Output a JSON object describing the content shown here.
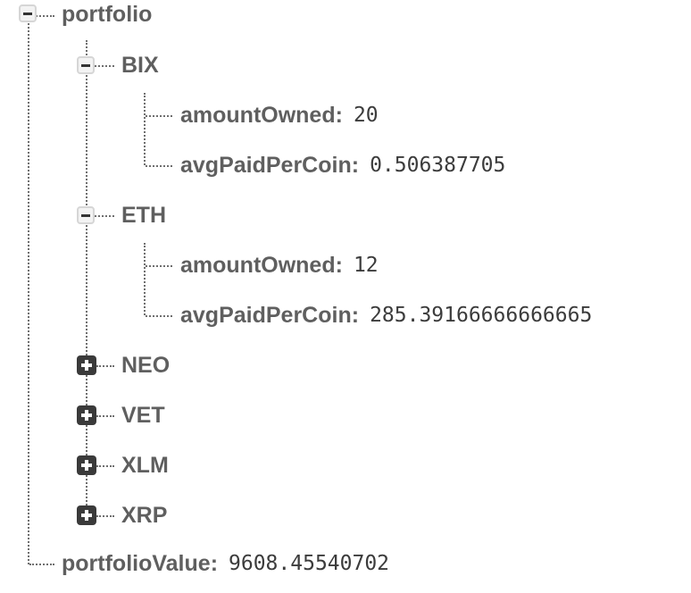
{
  "tree": {
    "root": {
      "key": "portfolio",
      "expanded": true,
      "children": {
        "bix": {
          "key": "BIX",
          "expanded": true,
          "fields": [
            {
              "key": "amountOwned",
              "value": "20"
            },
            {
              "key": "avgPaidPerCoin",
              "value": "0.506387705"
            }
          ]
        },
        "eth": {
          "key": "ETH",
          "expanded": true,
          "fields": [
            {
              "key": "amountOwned",
              "value": "12"
            },
            {
              "key": "avgPaidPerCoin",
              "value": "285.39166666666665"
            }
          ]
        },
        "neo": {
          "key": "NEO",
          "expanded": false
        },
        "vet": {
          "key": "VET",
          "expanded": false
        },
        "xlm": {
          "key": "XLM",
          "expanded": false
        },
        "xrp": {
          "key": "XRP",
          "expanded": false
        }
      }
    },
    "portfolio_value": {
      "key": "portfolioValue",
      "value": "9608.45540702"
    },
    "separator": ":"
  }
}
